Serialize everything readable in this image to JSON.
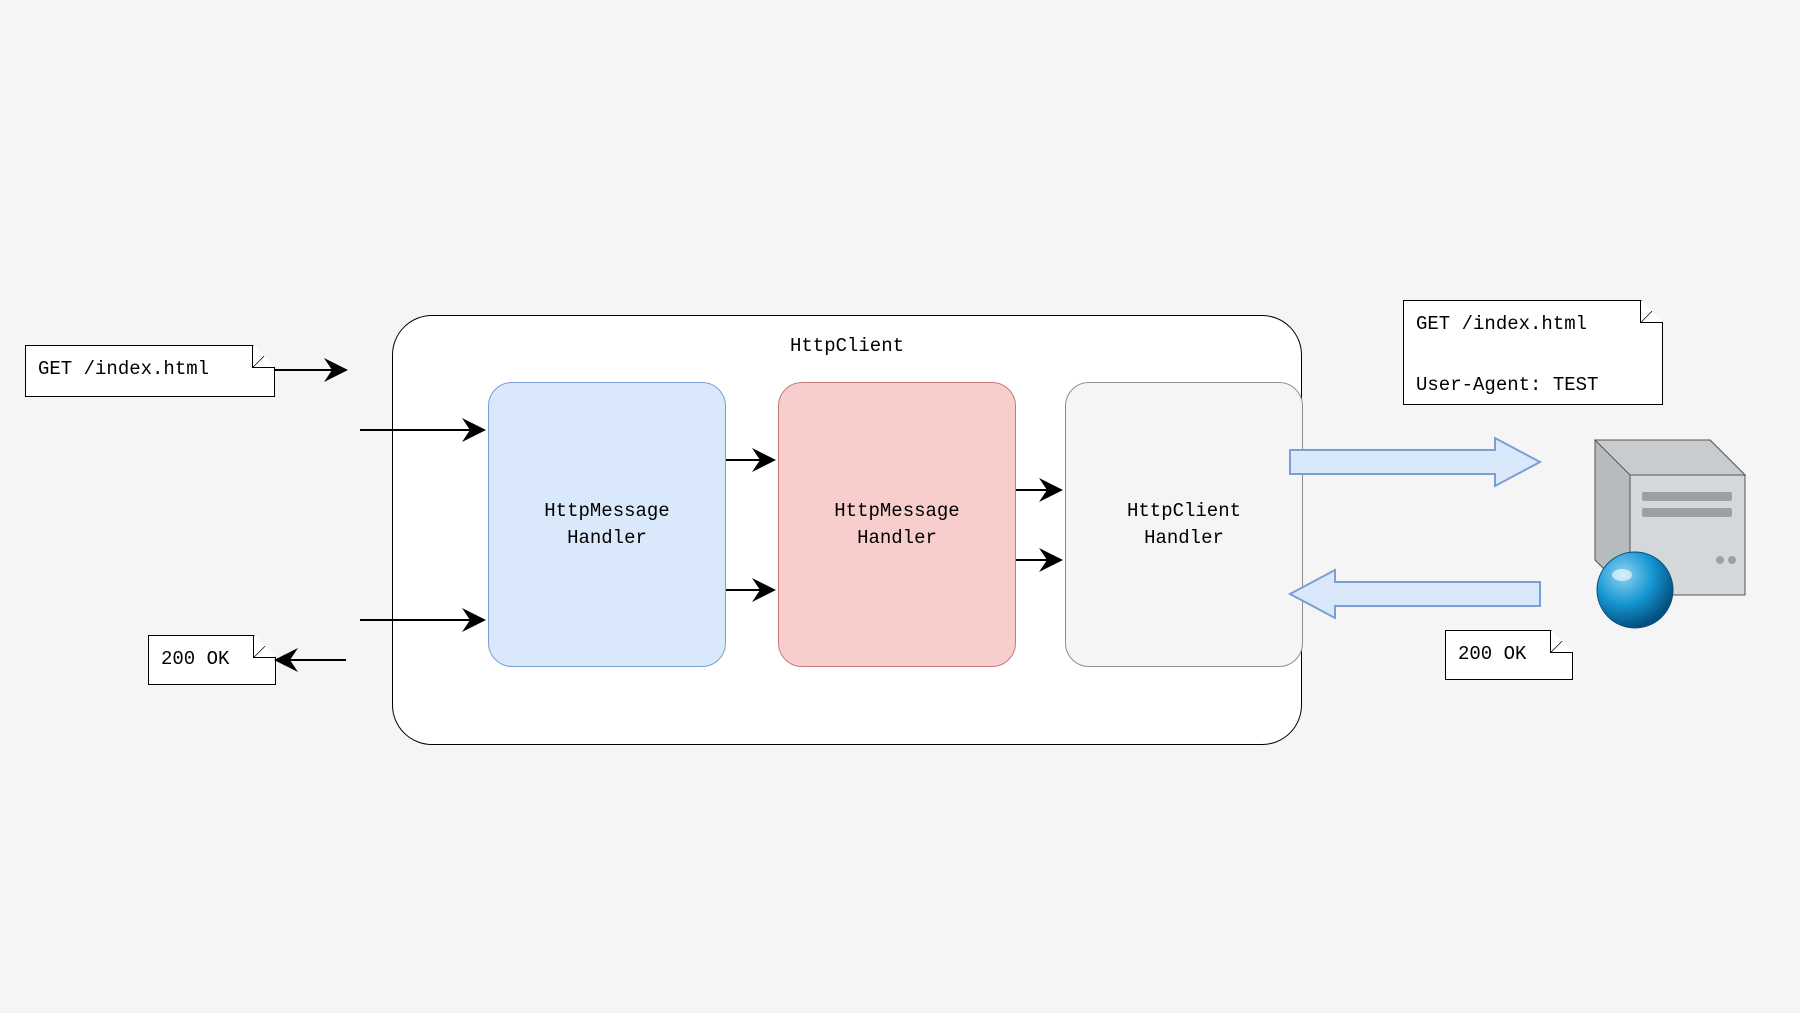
{
  "container": {
    "title": "HttpClient"
  },
  "handlers": {
    "h1": "HttpMessage\nHandler",
    "h2": "HttpMessage\nHandler",
    "h3": "HttpClient\nHandler"
  },
  "notes": {
    "request_left": "GET /index.html",
    "response_left": "200 OK",
    "request_right": "GET /index.html\n\nUser-Agent: TEST",
    "response_right": "200 OK"
  },
  "colors": {
    "blue_fill": "#dae8fc",
    "red_fill": "#f8cecc",
    "grey_fill": "#f5f5f5",
    "block_arrow_fill": "#dae8fc",
    "block_arrow_stroke": "#7a9fd4",
    "server_body": "#B6BBBE",
    "server_front": "#D5D8DA",
    "server_orb": "#0a7bbd"
  }
}
